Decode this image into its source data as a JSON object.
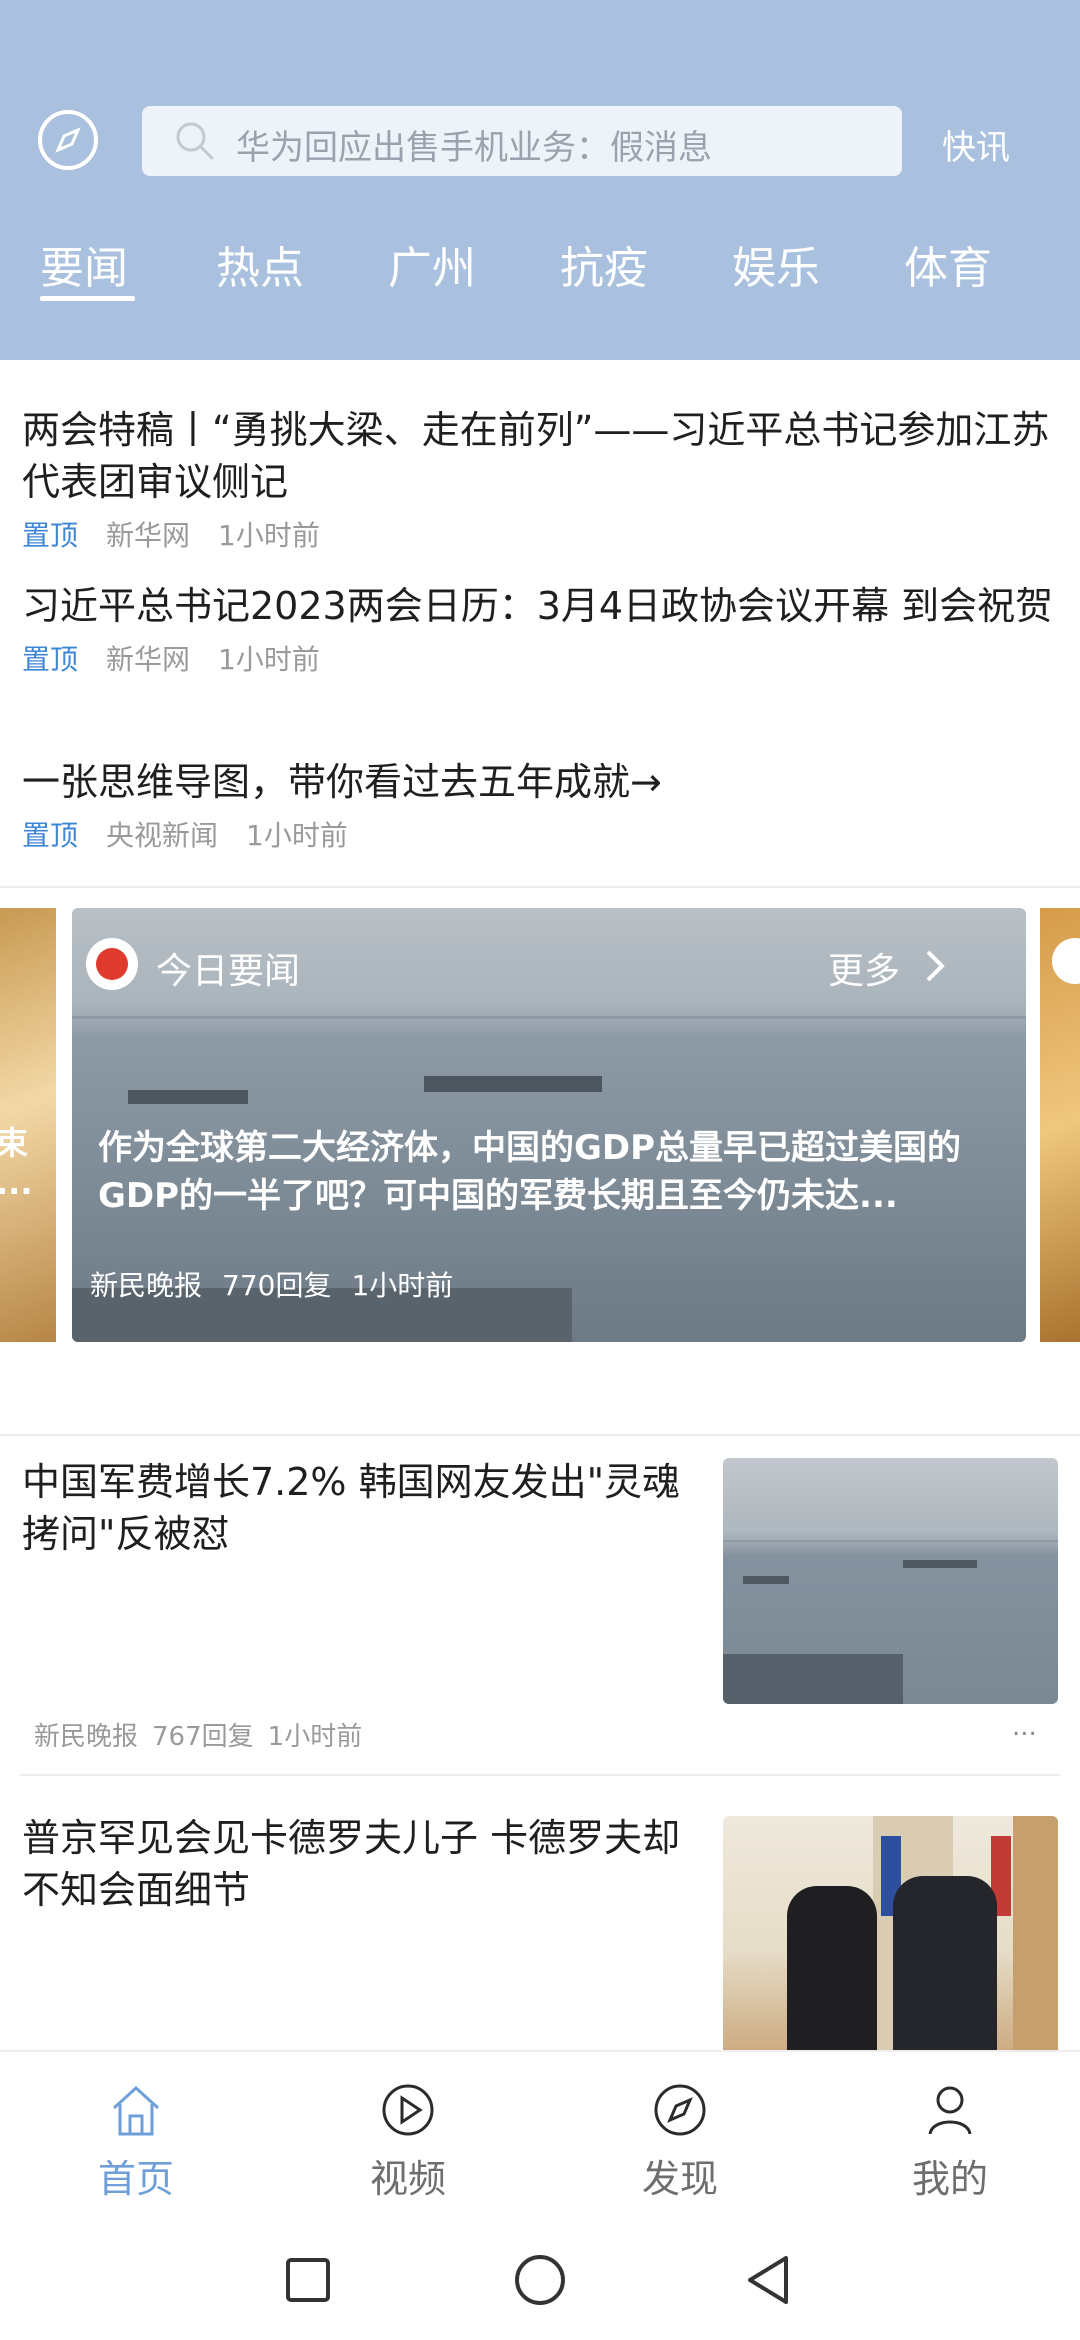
{
  "header": {
    "search_placeholder": "华为回应出售手机业务：假消息",
    "kuaixun": "快讯",
    "tabs": [
      {
        "label": "要闻",
        "active": true
      },
      {
        "label": "热点",
        "active": false
      },
      {
        "label": "广州",
        "active": false
      },
      {
        "label": "抗疫",
        "active": false
      },
      {
        "label": "娱乐",
        "active": false
      },
      {
        "label": "体育",
        "active": false
      }
    ]
  },
  "pinned": [
    {
      "title": "两会特稿丨“勇挑大梁、走在前列”——习近平总书记参加江苏代表团审议侧记",
      "tag": "置顶",
      "source": "新华网",
      "time": "1小时前"
    },
    {
      "title": "习近平总书记2023两会日历：3月4日政协会议开幕 到会祝贺",
      "tag": "置顶",
      "source": "新华网",
      "time": "1小时前"
    },
    {
      "title": "一张思维导图，带你看过去五年成就→",
      "tag": "置顶",
      "source": "央视新闻",
      "time": "1小时前"
    }
  ],
  "carousel": {
    "label": "今日要闻",
    "more": "更多",
    "title": "作为全球第二大经济体，中国的GDP总量早已超过美国的GDP的一半了吧？可中国的军费长期且至今仍未达...",
    "source": "新民晚报",
    "replies": "770回复",
    "time": "1小时前",
    "peek_left_text": "束\n..."
  },
  "news": [
    {
      "title": "中国军费增长7.2% 韩国网友发出\"灵魂拷问\"反被怼",
      "source": "新民晚报",
      "replies": "767回复",
      "time": "1小时前",
      "more": "..."
    },
    {
      "title": "普京罕见会见卡德罗夫儿子 卡德罗夫却不知会面细节"
    }
  ],
  "bottom_nav": [
    {
      "label": "首页",
      "icon": "home-icon",
      "active": true
    },
    {
      "label": "视频",
      "icon": "play-icon",
      "active": false
    },
    {
      "label": "发现",
      "icon": "compass-icon",
      "active": false
    },
    {
      "label": "我的",
      "icon": "user-icon",
      "active": false
    }
  ],
  "colors": {
    "header_bg": "#a9c1de",
    "accent_blue": "#3f86d4",
    "nav_active": "#6f9fd8"
  }
}
